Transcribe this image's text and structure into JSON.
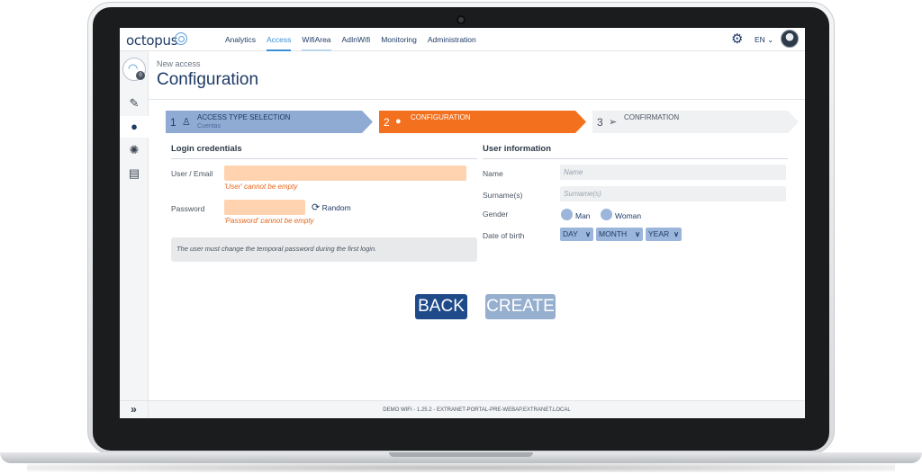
{
  "header": {
    "logo_text": "octopus",
    "nav": [
      "Analytics",
      "Access",
      "WifiArea",
      "AdInWifi",
      "Monitoring",
      "Administration"
    ],
    "active_nav": "Access",
    "language": "EN"
  },
  "sidebar": {
    "brand_badge": "0",
    "items": [
      "ticket-icon",
      "user-circle-icon",
      "settings-icon",
      "database-icon"
    ],
    "active_item": "user-circle-icon",
    "collapse_label": "»"
  },
  "page": {
    "breadcrumb": "New access",
    "title": "Configuration"
  },
  "steps": [
    {
      "number": "1",
      "label": "ACCESS TYPE SELECTION",
      "sub": "Cuentas",
      "state": "done"
    },
    {
      "number": "2",
      "label": "CONFIGURATION",
      "sub": "",
      "state": "active"
    },
    {
      "number": "3",
      "label": "CONFIRMATION",
      "sub": "",
      "state": "pending"
    }
  ],
  "login": {
    "section_title": "Login credentials",
    "user_label": "User / Email",
    "user_value": "",
    "user_error": "'User' cannot be empty",
    "password_label": "Password",
    "password_value": "",
    "password_error": "'Password' cannot be empty",
    "random_label": "Random",
    "note": "The user must change the temporal password during the first login."
  },
  "user_info": {
    "section_title": "User information",
    "name_label": "Name",
    "name_placeholder": "Name",
    "surname_label": "Surname(s)",
    "surname_placeholder": "Surname(s)",
    "gender_label": "Gender",
    "gender_options": [
      "Man",
      "Woman"
    ],
    "dob_label": "Date of birth",
    "dob_day": "DAY",
    "dob_month": "MONTH",
    "dob_year": "YEAR"
  },
  "actions": {
    "back_label": "BACK",
    "create_label": "CREATE"
  },
  "footer": {
    "text": "DEMO WIFI - 1.25.2 - EXTRANET-PORTAL-PRE-WEBAP.EXTRANET.LOCAL"
  },
  "colors": {
    "primary": "#1f4a8a",
    "accent": "#f3711e",
    "error_fill": "#ffd3b0",
    "step_done": "#8fabd4"
  }
}
